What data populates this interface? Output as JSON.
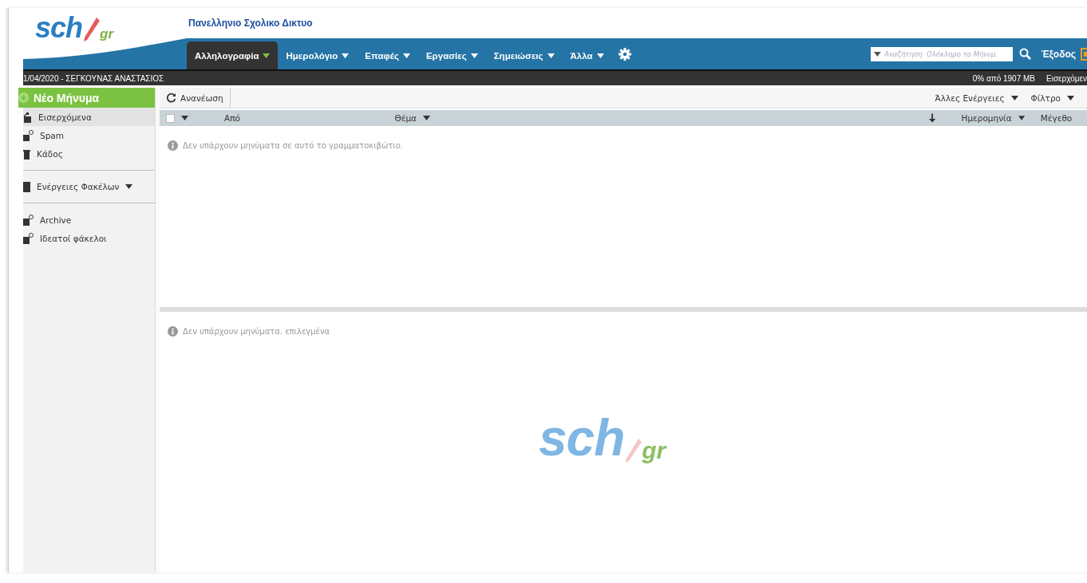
{
  "header": {
    "logo": {
      "main": "sch",
      "suffix": "gr"
    },
    "title": "Πανελληνιο Σχολικο Δικτυο"
  },
  "nav": [
    {
      "label": "Αλληλογραφία",
      "selected": true
    },
    {
      "label": "Ημερολόγιο",
      "selected": false
    },
    {
      "label": "Επαφές",
      "selected": false
    },
    {
      "label": "Εργασίες",
      "selected": false
    },
    {
      "label": "Σημειώσεις",
      "selected": false
    },
    {
      "label": "Άλλα",
      "selected": false
    }
  ],
  "search": {
    "placeholder": "Αναζήτηση  Ολόκληρο το Μήνυμ."
  },
  "logout": "Έξοδος",
  "status_bar": {
    "user": "1/04/2020 - ΣΕΓΚΟΥΝΑΣ ΑΝΑΣΤΑΣΙΟΣ",
    "quota": "0% από 1907 MB",
    "folder": "Εισερχόμεν"
  },
  "new_message": "Νέο Μήνυμα",
  "sidebar": {
    "folders": [
      {
        "label": "Εισερχόμενα",
        "selected": true,
        "kind": "inbox"
      },
      {
        "label": "Spam",
        "selected": false,
        "kind": "spam"
      },
      {
        "label": "Κάδος",
        "selected": false,
        "kind": "trash"
      }
    ],
    "folder_actions": "Ενέργειες Φακέλων",
    "extra": [
      {
        "label": "Archive",
        "selected": false,
        "kind": "folder"
      },
      {
        "label": "Ιδεατοί φάκελοι",
        "selected": false,
        "kind": "folder"
      }
    ]
  },
  "toolbar": {
    "refresh": "Ανανέωση",
    "more_actions": "Άλλες Ενέργειες",
    "filter": "Φίλτρο"
  },
  "table": {
    "columns": [
      {
        "label": "Από",
        "kind": "plain"
      },
      {
        "label": "Θέμα",
        "kind": "menu"
      },
      {
        "label": "Ημερομηνία",
        "kind": "sorted"
      },
      {
        "label": "Μέγεθο",
        "kind": "plain"
      }
    ],
    "select_all": {
      "checked": false
    },
    "empty_message": "Δεν υπάρχουν μηνύματα σε αυτό το γραμματοκιβώτιο."
  },
  "reading_pane": {
    "message": "Δεν υπάρχουν μηνύματα. επιλεγμένα",
    "logo": {
      "main": "sch",
      "suffix": "gr"
    }
  }
}
